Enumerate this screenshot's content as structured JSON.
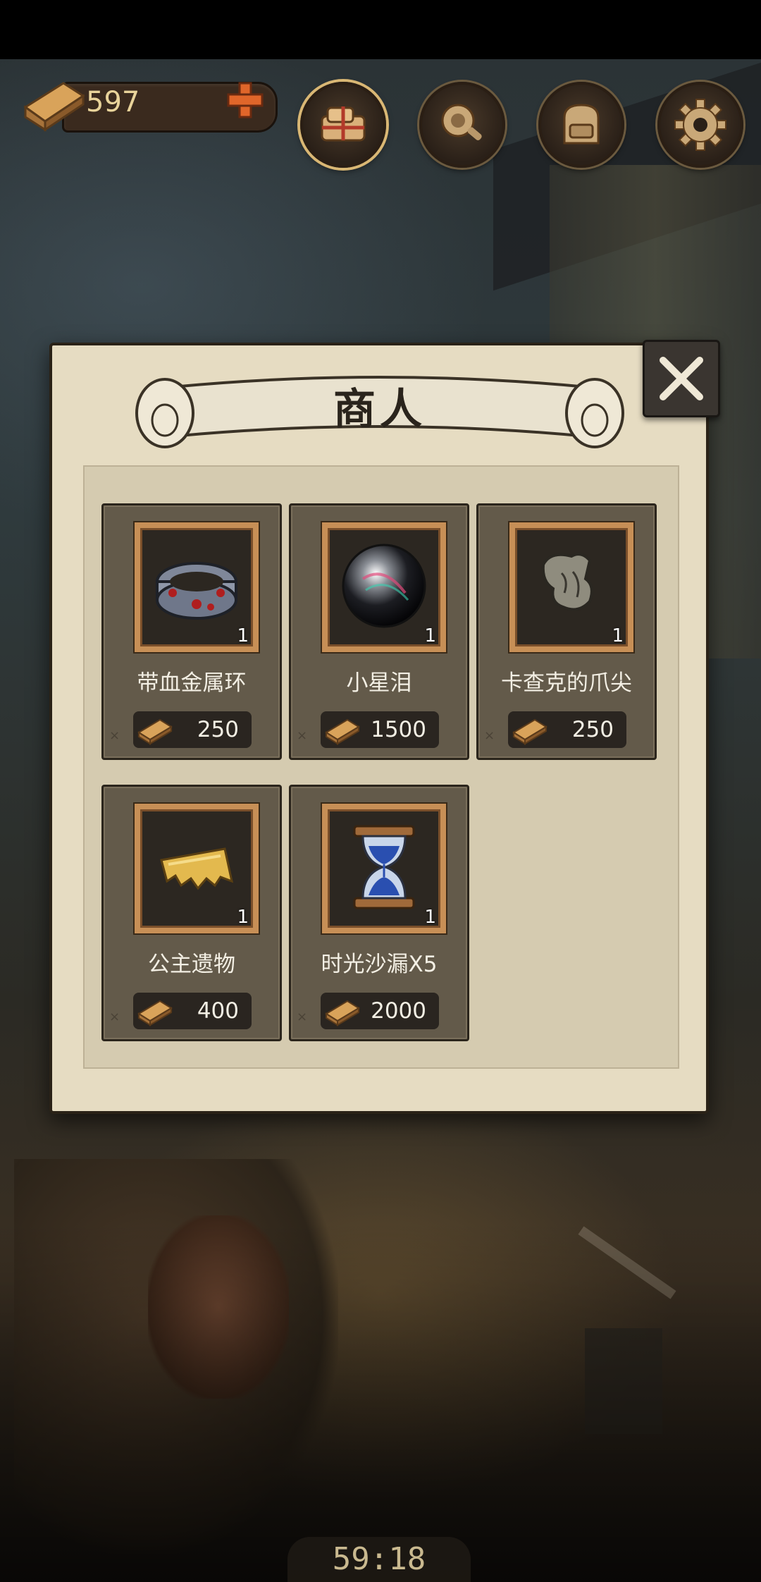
{
  "currency": {
    "wood": "597"
  },
  "topbar": {
    "buttons": [
      {
        "name": "shop",
        "icon": "bundle-icon"
      },
      {
        "name": "map",
        "icon": "horn-icon"
      },
      {
        "name": "bag",
        "icon": "backpack-icon"
      },
      {
        "name": "settings",
        "icon": "gear-icon"
      }
    ]
  },
  "panel": {
    "title": "商人"
  },
  "items": [
    {
      "name": "带血金属环",
      "qty": "1",
      "price": "250",
      "icon": "bloody-metal-ring-icon"
    },
    {
      "name": "小星泪",
      "qty": "1",
      "price": "1500",
      "icon": "star-tear-orb-icon"
    },
    {
      "name": "卡查克的爪尖",
      "qty": "1",
      "price": "250",
      "icon": "claw-tip-icon"
    },
    {
      "name": "公主遗物",
      "qty": "1",
      "price": "400",
      "icon": "cloth-scrap-icon"
    },
    {
      "name": "时光沙漏X5",
      "qty": "1",
      "price": "2000",
      "icon": "hourglass-icon"
    }
  ],
  "timer": "59:18",
  "colors": {
    "accent": "#c78f56",
    "panel": "#e6dcc2",
    "card": "#635a4a"
  }
}
